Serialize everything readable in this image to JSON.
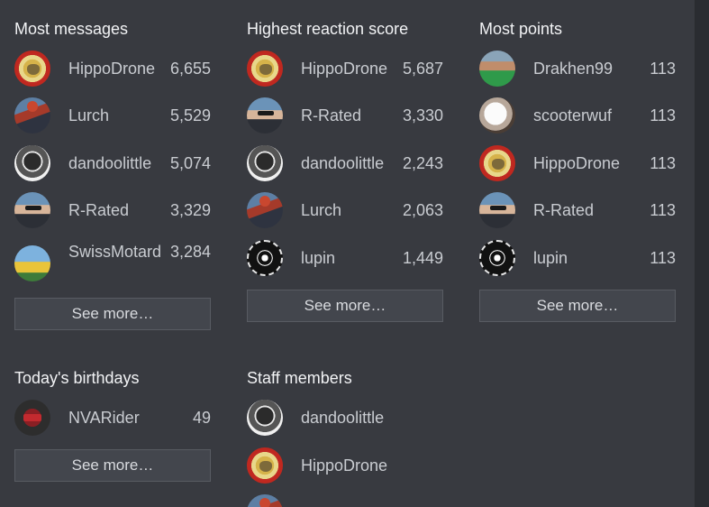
{
  "most_messages": {
    "title": "Most messages",
    "rows": [
      {
        "name": "HippoDrone",
        "value": "6,655",
        "avatar": "hippodrone-avatar"
      },
      {
        "name": "Lurch",
        "value": "5,529",
        "avatar": "lurch-avatar"
      },
      {
        "name": "dandoolittle",
        "value": "5,074",
        "avatar": "dandoolittle-avatar"
      },
      {
        "name": "R-Rated",
        "value": "3,329",
        "avatar": "r-rated-avatar"
      },
      {
        "name": "SwissMotard",
        "value": "3,284",
        "avatar": "swissmotard-avatar"
      }
    ],
    "see_more": "See more…"
  },
  "highest_reaction": {
    "title": "Highest reaction score",
    "rows": [
      {
        "name": "HippoDrone",
        "value": "5,687"
      },
      {
        "name": "R-Rated",
        "value": "3,330"
      },
      {
        "name": "dandoolittle",
        "value": "2,243"
      },
      {
        "name": "Lurch",
        "value": "2,063"
      },
      {
        "name": "lupin",
        "value": "1,449"
      }
    ],
    "see_more": "See more…"
  },
  "most_points": {
    "title": "Most points",
    "rows": [
      {
        "name": "Drakhen99",
        "value": "113"
      },
      {
        "name": "scooterwuf",
        "value": "113"
      },
      {
        "name": "HippoDrone",
        "value": "113"
      },
      {
        "name": "R-Rated",
        "value": "113"
      },
      {
        "name": "lupin",
        "value": "113"
      }
    ],
    "see_more": "See more…"
  },
  "birthdays": {
    "title": "Today's birthdays",
    "rows": [
      {
        "name": "NVARider",
        "value": "49"
      }
    ],
    "see_more": "See more…"
  },
  "staff": {
    "title": "Staff members",
    "rows": [
      {
        "name": "dandoolittle"
      },
      {
        "name": "HippoDrone"
      }
    ]
  }
}
